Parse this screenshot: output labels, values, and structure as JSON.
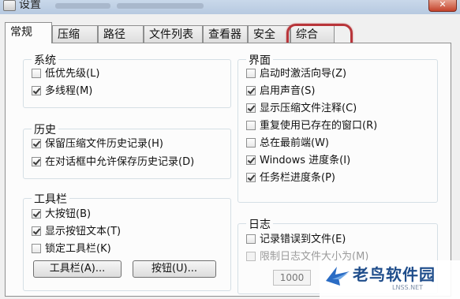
{
  "window": {
    "title": "设置"
  },
  "tabs": [
    {
      "label": "常规",
      "active": true
    },
    {
      "label": "压缩"
    },
    {
      "label": "路径"
    },
    {
      "label": "文件列表"
    },
    {
      "label": "查看器"
    },
    {
      "label": "安全"
    },
    {
      "label": "综合"
    }
  ],
  "groups": {
    "system": {
      "title": "系统",
      "options": [
        {
          "label": "低优先级(L)",
          "checked": false
        },
        {
          "label": "多线程(M)",
          "checked": true
        }
      ]
    },
    "history": {
      "title": "历史",
      "options": [
        {
          "label": "保留压缩文件历史记录(H)",
          "checked": true
        },
        {
          "label": "在对话框中允许保存历史记录(D)",
          "checked": true
        }
      ]
    },
    "toolbar": {
      "title": "工具栏",
      "options": [
        {
          "label": "大按钮(B)",
          "checked": true
        },
        {
          "label": "显示按钮文本(T)",
          "checked": true
        },
        {
          "label": "锁定工具栏(K)",
          "checked": false
        }
      ],
      "buttons": {
        "toolbar": "工具栏(A)...",
        "buttons": "按钮(U)..."
      }
    },
    "interface": {
      "title": "界面",
      "options": [
        {
          "label": "启动时激活向导(Z)",
          "checked": false
        },
        {
          "label": "启用声音(S)",
          "checked": true
        },
        {
          "label": "显示压缩文件注释(C)",
          "checked": true
        },
        {
          "label": "重复使用已存在的窗口(R)",
          "checked": false
        },
        {
          "label": "总在最前端(W)",
          "checked": false
        },
        {
          "label": "Windows 进度条(I)",
          "checked": true
        },
        {
          "label": "任务栏进度条(P)",
          "checked": true
        }
      ]
    },
    "log": {
      "title": "日志",
      "options": [
        {
          "label": "记录错误到文件(E)",
          "checked": false
        },
        {
          "label": "限制日志文件大小为(M)",
          "checked": false,
          "disabled": true
        }
      ],
      "size_value": "1000"
    }
  },
  "watermark": {
    "text": "老鸟软件园",
    "sub": "LNSS.NET"
  },
  "colors": {
    "highlight": "#b8353a",
    "watermark": "#1f4d8b"
  }
}
